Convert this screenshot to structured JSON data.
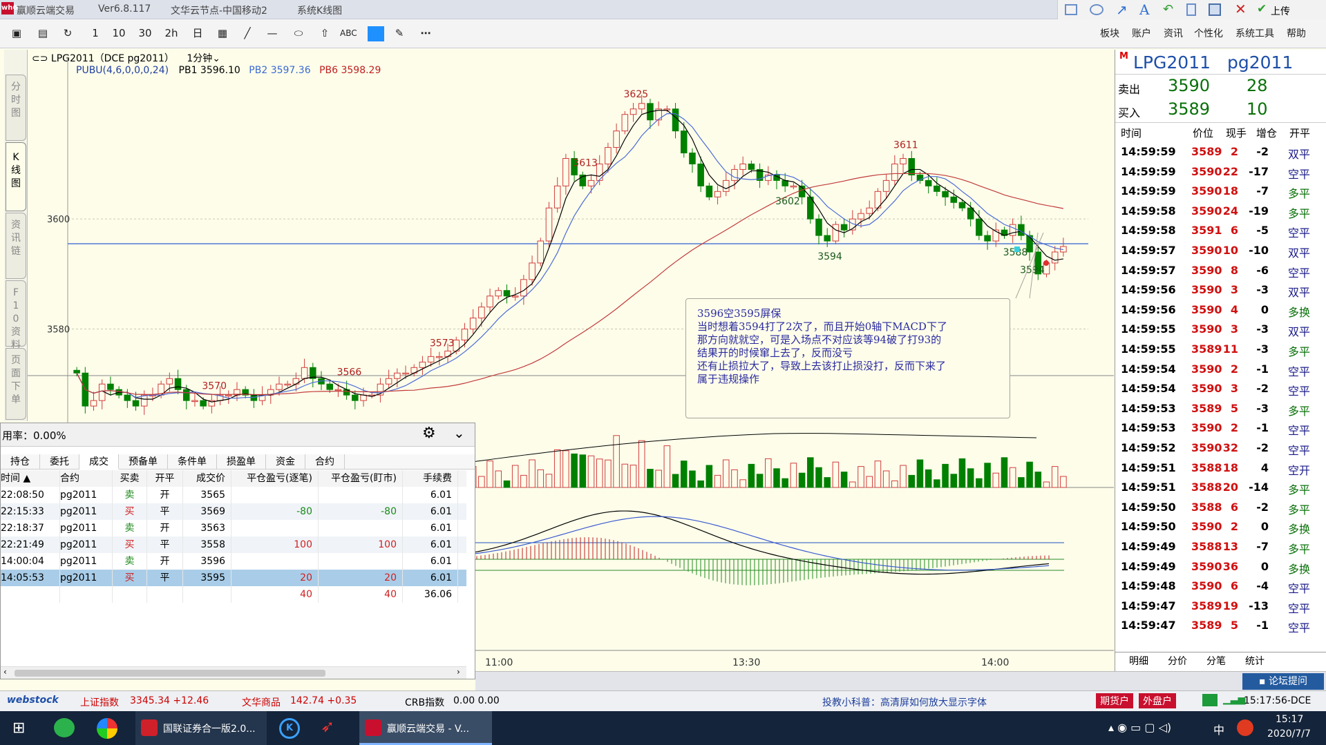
{
  "window": {
    "logo_text": "wh6",
    "app_name": "赢顺云端交易",
    "version": "Ver6.8.117",
    "server": "文华云节点-中国移动2",
    "chart_mode": "系统K线图",
    "upload": "上传"
  },
  "toolbar": {
    "buttons": [
      "1",
      "10",
      "30",
      "2h",
      "日"
    ],
    "menus": [
      "板块",
      "账户",
      "资讯",
      "个性化",
      "系统工具",
      "帮助"
    ],
    "color_swatch": "#1e90ff"
  },
  "left_tabs": [
    "分时图",
    "K线图",
    "资讯链",
    "F10资料",
    "页面下单"
  ],
  "chart": {
    "contract_label": "LPG2011（DCE pg2011）",
    "period": "1分钟",
    "indicator": "PUBU(4,6,0,0,0,24)",
    "pb1": "PB1 3596.10",
    "pb2": "PB2 3597.36",
    "pb6": "PB6 3598.29",
    "y_ticks": [
      "3600",
      "3580"
    ],
    "x_ticks": [
      "11:00",
      "13:30",
      "14:00"
    ],
    "price_labels": [
      "3625",
      "3613",
      "3611",
      "3602",
      "3594",
      "3594",
      "3588",
      "3573",
      "3570",
      "3566"
    ],
    "annotation": [
      "3596空3595屏保",
      "当时想着3594打了2次了，而且开始0轴下MACD下了",
      "那方向就就空，可是入场点不对应该等94破了打93的",
      "结果开的时候窜上去了，反而没亏",
      "还有止损拉大了，导致上去该打止损没打，反而下来了",
      "属于违规操作"
    ],
    "colors": {
      "up": "#d23c3c",
      "down": "#008000",
      "ma_blue": "#4b6bd6",
      "ma_red": "#c23a3a",
      "ma_black": "#000000",
      "hline": "#3060d0"
    }
  },
  "chart_data": {
    "type": "candlestick",
    "symbol": "pg2011",
    "period": "1分钟",
    "ylim": [
      3563,
      3627
    ],
    "x_ticks": [
      "11:00",
      "13:30",
      "14:00"
    ],
    "highlight_price": 3595.5,
    "close": [
      3572,
      3566,
      3567,
      3570,
      3569,
      3568,
      3567,
      3566,
      3568,
      3568,
      3570,
      3571,
      3569,
      3567,
      3567,
      3566,
      3567,
      3568,
      3568,
      3569,
      3568,
      3567,
      3568,
      3569,
      3570,
      3570,
      3571,
      3573,
      3571,
      3570,
      3569,
      3569,
      3568,
      3567,
      3568,
      3568,
      3570,
      3571,
      3572,
      3572,
      3573,
      3574,
      3575,
      3575,
      3576,
      3578,
      3580,
      3582,
      3584,
      3586,
      3587,
      3586,
      3586,
      3589,
      3592,
      3596,
      3602,
      3606,
      3611,
      3608,
      3606,
      3607,
      3610,
      3613,
      3616,
      3619,
      3620,
      3621,
      3618,
      3620,
      3620,
      3616,
      3612,
      3610,
      3606,
      3604,
      3605,
      3607,
      3609,
      3610,
      3609,
      3607,
      3608,
      3607,
      3606,
      3606,
      3604,
      3600,
      3597,
      3596,
      3599,
      3598,
      3600,
      3601,
      3602,
      3605,
      3607,
      3610,
      3611,
      3608,
      3607,
      3606,
      3605,
      3604,
      3603,
      3602,
      3600,
      3597,
      3596,
      3598,
      3597,
      3599,
      3597,
      3594,
      3590,
      3592,
      3594,
      3595
    ]
  },
  "macd_lines": {
    "note": "volume and MACD subcharts"
  },
  "quote": {
    "marker": "M",
    "name": "LPG2011",
    "code": "pg2011",
    "sell_label": "卖出",
    "sell_price": "3590",
    "sell_vol": "28",
    "buy_label": "买入",
    "buy_price": "3589",
    "buy_vol": "10",
    "headers": [
      "时间",
      "价位",
      "现手",
      "增仓",
      "开平"
    ],
    "ticks": [
      [
        "14:59:59",
        "3589",
        "2",
        "-2",
        "双平"
      ],
      [
        "14:59:59",
        "3590",
        "22",
        "-17",
        "空平"
      ],
      [
        "14:59:59",
        "3590",
        "18",
        "-7",
        "多平"
      ],
      [
        "14:59:58",
        "3590",
        "24",
        "-19",
        "多平"
      ],
      [
        "14:59:58",
        "3591",
        "6",
        "-5",
        "空平"
      ],
      [
        "14:59:57",
        "3590",
        "10",
        "-10",
        "双平"
      ],
      [
        "14:59:57",
        "3590",
        "8",
        "-6",
        "空平"
      ],
      [
        "14:59:56",
        "3590",
        "3",
        "-3",
        "双平"
      ],
      [
        "14:59:56",
        "3590",
        "4",
        "0",
        "多换"
      ],
      [
        "14:59:55",
        "3590",
        "3",
        "-3",
        "双平"
      ],
      [
        "14:59:55",
        "3589",
        "11",
        "-3",
        "多平"
      ],
      [
        "14:59:54",
        "3590",
        "2",
        "-1",
        "空平"
      ],
      [
        "14:59:54",
        "3590",
        "3",
        "-2",
        "空平"
      ],
      [
        "14:59:53",
        "3589",
        "5",
        "-3",
        "多平"
      ],
      [
        "14:59:53",
        "3590",
        "2",
        "-1",
        "空平"
      ],
      [
        "14:59:52",
        "3590",
        "32",
        "-2",
        "空平"
      ],
      [
        "14:59:51",
        "3588",
        "18",
        "4",
        "空开"
      ],
      [
        "14:59:51",
        "3588",
        "20",
        "-14",
        "多平"
      ],
      [
        "14:59:50",
        "3588",
        "6",
        "-2",
        "多平"
      ],
      [
        "14:59:50",
        "3590",
        "2",
        "0",
        "多换"
      ],
      [
        "14:59:49",
        "3588",
        "13",
        "-7",
        "多平"
      ],
      [
        "14:59:49",
        "3590",
        "36",
        "0",
        "多换"
      ],
      [
        "14:59:48",
        "3590",
        "6",
        "-4",
        "空平"
      ],
      [
        "14:59:47",
        "3589",
        "19",
        "-13",
        "空平"
      ],
      [
        "14:59:47",
        "3589",
        "5",
        "-1",
        "空平"
      ]
    ],
    "bottom_tabs": [
      "明细",
      "分价",
      "分笔",
      "统计"
    ],
    "forum": "论坛提问"
  },
  "trade_panel": {
    "usage": "用率：0.00%",
    "tabs": [
      "持仓",
      "委托",
      "成交",
      "预备单",
      "条件单",
      "损盈单",
      "资金",
      "合约"
    ],
    "active_tab": "成交",
    "headers": [
      "时间",
      "合约",
      "买卖",
      "开平",
      "成交价",
      "平仓盈亏(逐笔)",
      "平仓盈亏(盯市)",
      "手续费"
    ],
    "rows": [
      [
        "22:08:50",
        "pg2011",
        "卖",
        "开",
        "3565",
        "",
        "",
        "6.01"
      ],
      [
        "22:15:33",
        "pg2011",
        "买",
        "平",
        "3569",
        "-80",
        "-80",
        "6.01"
      ],
      [
        "22:18:37",
        "pg2011",
        "卖",
        "开",
        "3563",
        "",
        "",
        "6.01"
      ],
      [
        "22:21:49",
        "pg2011",
        "买",
        "平",
        "3558",
        "100",
        "100",
        "6.01"
      ],
      [
        "14:00:04",
        "pg2011",
        "卖",
        "开",
        "3596",
        "",
        "",
        "6.01"
      ],
      [
        "14:05:53",
        "pg2011",
        "买",
        "平",
        "3595",
        "20",
        "20",
        "6.01"
      ],
      [
        "",
        "",
        "",
        "",
        "",
        "40",
        "40",
        "36.06"
      ]
    ]
  },
  "status": {
    "brand": "webstock",
    "idx1_name": "上证指数",
    "idx1_val": "3345.34 +12.46",
    "idx2_name": "文华商品",
    "idx2_val": "142.74 +0.35",
    "idx3_name": "CRB指数",
    "idx3_val": "0.00 0.00",
    "tip": "投教小科普：高清屏如何放大显示字体",
    "acct1": "期货户",
    "acct2": "外盘户",
    "clock": "15:17:56-DCE"
  },
  "taskbar": {
    "apps": [
      "国联证券合一版2.0...",
      "赢顺云端交易 - V..."
    ],
    "time": "15:17",
    "date": "2020/7/7",
    "ime": "中"
  }
}
